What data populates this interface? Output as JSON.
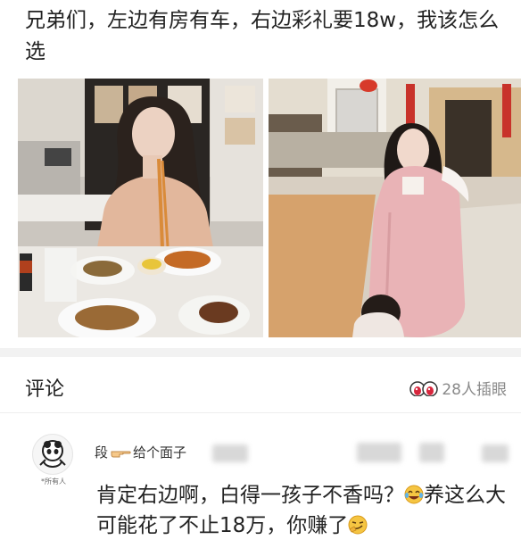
{
  "post": {
    "title": "兄弟们，左边有房有车，右边彩礼要18w，我该怎么选"
  },
  "comments_section": {
    "title": "评论",
    "watchers_label": "28人插眼",
    "watchers_icon": "eyes-icon"
  },
  "comment": {
    "avatar_caption": "*所有人",
    "username_prefix": "段",
    "username_icon": "pointing-hand-icon",
    "username_suffix": "给个面子",
    "text_part1": "肯定右边啊，白得一孩子不香吗？",
    "text_part2": "养这么大可能花了不止18万，你赚了",
    "emoji_1": "laughing-tears-emoji",
    "emoji_2": "smirk-emoji"
  },
  "colors": {
    "secondary_text": "#8a8a8a",
    "separator": "#f2f2f2"
  }
}
